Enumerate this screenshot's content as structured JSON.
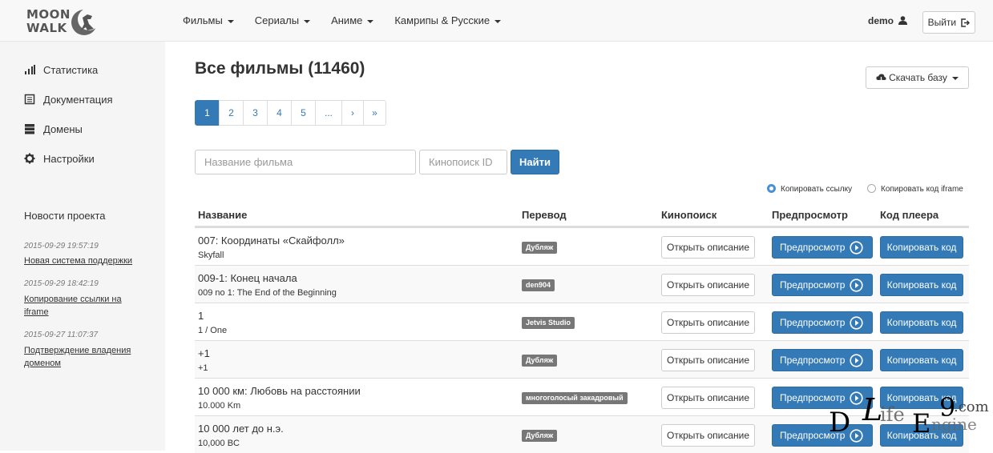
{
  "header": {
    "logo_line1": "MOON",
    "logo_line2": "WALK",
    "menu": [
      {
        "label": "Фильмы"
      },
      {
        "label": "Сериалы"
      },
      {
        "label": "Аниме"
      },
      {
        "label": "Камрипы & Русские"
      }
    ],
    "user": "demo",
    "logout_label": "Выйти"
  },
  "sidebar": {
    "items": [
      {
        "label": "Статистика",
        "icon": "bar-chart-icon"
      },
      {
        "label": "Документация",
        "icon": "book-icon"
      },
      {
        "label": "Домены",
        "icon": "server-icon"
      },
      {
        "label": "Настройки",
        "icon": "gear-icon"
      }
    ],
    "news_title": "Новости проекта",
    "news": [
      {
        "date": "2015-09-29 19:57:19",
        "text": "Новая система поддержки"
      },
      {
        "date": "2015-09-29 18:42:19",
        "text": "Копирование ссылки на iframe"
      },
      {
        "date": "2015-09-27 11:07:37",
        "text": "Подтверждение владения доменом"
      }
    ]
  },
  "main": {
    "title": "Все фильмы (11460)",
    "download_label": "Скачать базу",
    "pagination": [
      "1",
      "2",
      "3",
      "4",
      "5",
      "...",
      "›",
      "»"
    ],
    "active_page": "1",
    "search": {
      "name_placeholder": "Название фильма",
      "kp_placeholder": "Кинопоиск ID",
      "button": "Найти"
    },
    "copy_options": {
      "link": "Копировать ссылку",
      "iframe": "Копировать код iframe",
      "selected": "link"
    },
    "table": {
      "headers": [
        "Название",
        "Перевод",
        "Кинопоиск",
        "Предпросмотр",
        "Код плеера"
      ],
      "open_label": "Открыть описание",
      "preview_label": "Предпросмотр",
      "copy_label": "Копировать код",
      "rows": [
        {
          "title": "007: Координаты «Скайфолл»",
          "original": "Skyfall",
          "translation": "Дубляж"
        },
        {
          "title": "009-1: Конец начала",
          "original": "009 no 1: The End of the Beginning",
          "translation": "den904"
        },
        {
          "title": "1",
          "original": "1 / One",
          "translation": "Jetvis Studio"
        },
        {
          "title": "+1",
          "original": "+1",
          "translation": "Дубляж"
        },
        {
          "title": "10 000 км: Любовь на расстоянии",
          "original": "10.000 Km",
          "translation": "многоголосый закадровый"
        },
        {
          "title": "10 000 лет до н.э.",
          "original": "10,000 BC",
          "translation": "Дубляж"
        }
      ]
    }
  },
  "watermark": {
    "letters": [
      "D",
      "L",
      "ife",
      "E",
      "ngine",
      "9",
      ".com"
    ]
  },
  "colors": {
    "primary": "#337ab7",
    "badge": "#777777",
    "sidebar_bg": "#f5f5f5",
    "navbar_bg": "#f8f8f8"
  }
}
